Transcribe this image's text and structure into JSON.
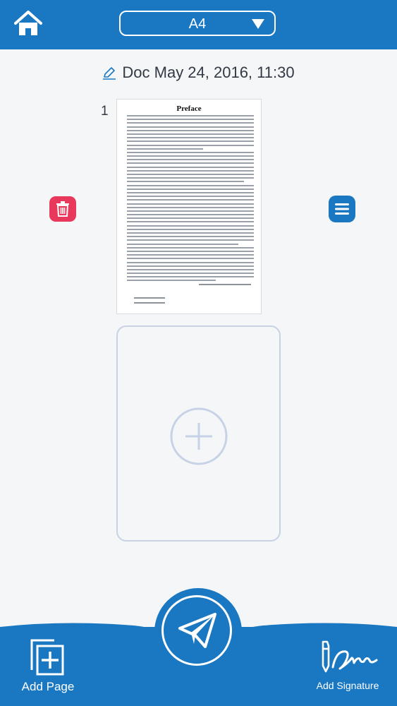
{
  "header": {
    "home_icon": "home-icon",
    "page_size": "A4",
    "dropdown_icon": "triangle-down-icon"
  },
  "document": {
    "title": "Doc May 24, 2016, 11:30",
    "edit_icon": "pencil-icon"
  },
  "pages": [
    {
      "number": "1",
      "heading": "Preface"
    }
  ],
  "page_actions": {
    "delete_icon": "trash-icon",
    "menu_icon": "menu-icon"
  },
  "add_page_placeholder": {
    "icon": "plus-circle-icon"
  },
  "bottom_bar": {
    "add_page_label": "Add Page",
    "send_icon": "paper-plane-icon",
    "add_signature_label": "Add Signature"
  },
  "colors": {
    "primary": "#1a78c2",
    "danger": "#e8385b",
    "background": "#f5f6f8",
    "placeholder_border": "#c7d2e6"
  }
}
